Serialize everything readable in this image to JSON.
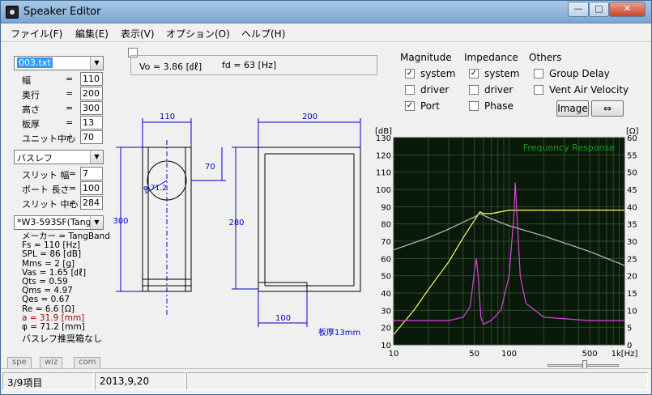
{
  "window": {
    "title": "Speaker Editor",
    "min": "—",
    "max": "□",
    "close": "✕"
  },
  "menu": [
    "ファイル(F)",
    "編集(E)",
    "表示(V)",
    "オプション(O)",
    "ヘルプ(H)"
  ],
  "file_select": "003.txt",
  "box_params": [
    {
      "label": "幅",
      "value": "110"
    },
    {
      "label": "奥行",
      "value": "200"
    },
    {
      "label": "高さ",
      "value": "300"
    },
    {
      "label": "板厚",
      "value": "13"
    },
    {
      "label": "ユニット中心",
      "value": "70"
    }
  ],
  "equals": "=",
  "type_select": "バスレフ",
  "port_params": [
    {
      "label": "スリット 幅",
      "value": "7"
    },
    {
      "label": "ポート 長さ",
      "value": "100"
    },
    {
      "label": "スリット 中心",
      "value": "284"
    }
  ],
  "unit_select": "*W3-593SF(Tangl",
  "specs": [
    "メーカー = TangBand",
    "Fs  = 110 [Hz]",
    "SPL  = 86 [dB]",
    "Mms  = 2 [g]",
    "Vas  = 1.65 [㎗]",
    "Qts  = 0.59",
    "Qms  = 4.97",
    "Qes  = 0.67",
    "Re  = 6.6 [Ω]"
  ],
  "specs_red": [
    "a   = 31.9 [mm]"
  ],
  "specs_after": [
    "φ   = 71.2 [mm]",
    "バスレフ推奨箱なし"
  ],
  "tabs": [
    "spe",
    "wiz",
    "com"
  ],
  "status": {
    "item": "3/9項目",
    "date": "2013,9,20"
  },
  "info": {
    "vo": "Vo   = 3.86 [㎗]",
    "fd": "fd   = 63 [Hz]"
  },
  "drawing": {
    "front_width": "110",
    "side_depth": "200",
    "unit_center": "70",
    "height": "300",
    "inner_height": "280",
    "diameter": "φ 71.2",
    "port_len": "100",
    "thickness": "板厚13mm"
  },
  "controls": {
    "magnitude": "Magnitude",
    "impedance": "Impedance",
    "others": "Others",
    "mag_items": [
      {
        "label": "system",
        "checked": true
      },
      {
        "label": "driver",
        "checked": false
      },
      {
        "label": "Port",
        "checked": true
      }
    ],
    "imp_items": [
      {
        "label": "system",
        "checked": true
      },
      {
        "label": "driver",
        "checked": false
      },
      {
        "label": "Phase",
        "checked": false
      }
    ],
    "other_items": [
      {
        "label": "Group Delay",
        "checked": false
      },
      {
        "label": "Vent Air Velocity",
        "checked": false
      }
    ],
    "image_btn": "Image",
    "swap_btn": "⇔"
  },
  "chart_data": {
    "type": "line",
    "title": "Frequency Response",
    "left_unit": "[dB]",
    "right_unit": "[Ω]",
    "y_left_ticks": [
      "130",
      "120",
      "110",
      "100",
      "90",
      "80",
      "70",
      "60",
      "50",
      "40",
      "30",
      "20",
      "10"
    ],
    "y_right_ticks": [
      "60",
      "55",
      "50",
      "45",
      "40",
      "35",
      "30",
      "25",
      "20",
      "15",
      "10",
      "5",
      "0"
    ],
    "x_ticks": [
      "10",
      "50",
      "100",
      "500",
      "1k[Hz]"
    ],
    "x_scale": "log",
    "xlim": [
      10,
      1000
    ],
    "ylim_left": [
      10,
      130
    ],
    "ylim_right": [
      0,
      60
    ],
    "grid": true,
    "colors": {
      "bg": "#0a1a0a",
      "grid": "#2d4a2d",
      "system": "#ffff66",
      "port": "#c0c0c0",
      "impedance": "#e040e0",
      "title": "#1a9a1a"
    },
    "series": [
      {
        "color_key": "system",
        "axis": "left",
        "points": [
          [
            10,
            16
          ],
          [
            15,
            30
          ],
          [
            20,
            42
          ],
          [
            30,
            58
          ],
          [
            40,
            72
          ],
          [
            50,
            82
          ],
          [
            56,
            87
          ],
          [
            60,
            86
          ],
          [
            70,
            86
          ],
          [
            100,
            88
          ],
          [
            150,
            88
          ],
          [
            200,
            88
          ],
          [
            500,
            88
          ],
          [
            1000,
            88
          ]
        ]
      },
      {
        "color_key": "port",
        "axis": "left",
        "points": [
          [
            10,
            65
          ],
          [
            20,
            72
          ],
          [
            30,
            77
          ],
          [
            40,
            81
          ],
          [
            50,
            84
          ],
          [
            56,
            86
          ],
          [
            70,
            83
          ],
          [
            100,
            79
          ],
          [
            200,
            73
          ],
          [
            500,
            64
          ],
          [
            1000,
            56
          ]
        ]
      },
      {
        "color_key": "impedance",
        "axis": "right",
        "points": [
          [
            10,
            7
          ],
          [
            30,
            7
          ],
          [
            40,
            8
          ],
          [
            46,
            11
          ],
          [
            50,
            21
          ],
          [
            52,
            25
          ],
          [
            54,
            20
          ],
          [
            57,
            8
          ],
          [
            60,
            6
          ],
          [
            70,
            7
          ],
          [
            85,
            10
          ],
          [
            100,
            20
          ],
          [
            110,
            37
          ],
          [
            113,
            47
          ],
          [
            116,
            40
          ],
          [
            125,
            20
          ],
          [
            140,
            12
          ],
          [
            200,
            8
          ],
          [
            500,
            7
          ],
          [
            1000,
            7
          ]
        ]
      }
    ]
  }
}
